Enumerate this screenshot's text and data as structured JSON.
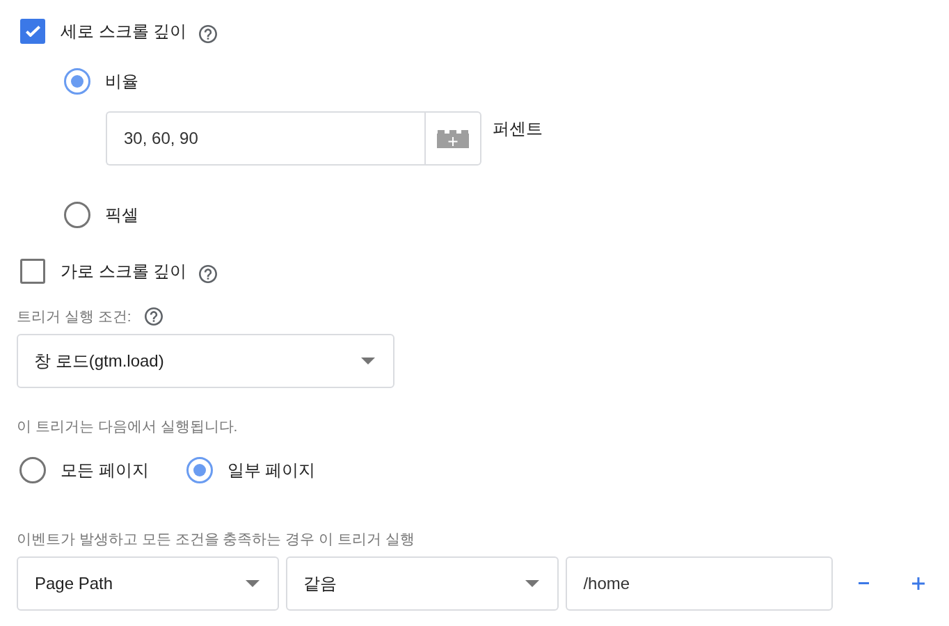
{
  "scroll_depths": [
    {
      "label": "세로 스크롤 깊이",
      "checked": true,
      "units": {
        "options": [
          {
            "label": "비율",
            "selected": true,
            "field": {
              "value": "30, 60, 90",
              "unit": "퍼센트"
            }
          },
          {
            "label": "픽셀",
            "selected": false
          }
        ]
      }
    },
    {
      "label": "가로 스크롤 깊이",
      "checked": false
    }
  ],
  "fire_condition": {
    "label": "트리거 실행 조건:",
    "selected_value": "창 로드(gtm.load)"
  },
  "fires_on": {
    "label": "이 트리거는 다음에서 실행됩니다.",
    "options": [
      {
        "label": "모든 페이지",
        "selected": false
      },
      {
        "label": "일부 페이지",
        "selected": true
      }
    ]
  },
  "conditions": {
    "label": "이벤트가 발생하고 모든 조건을 충족하는 경우 이 트리거 실행",
    "rows": [
      {
        "variable": "Page Path",
        "operator": "같음",
        "value": "/home"
      }
    ]
  }
}
